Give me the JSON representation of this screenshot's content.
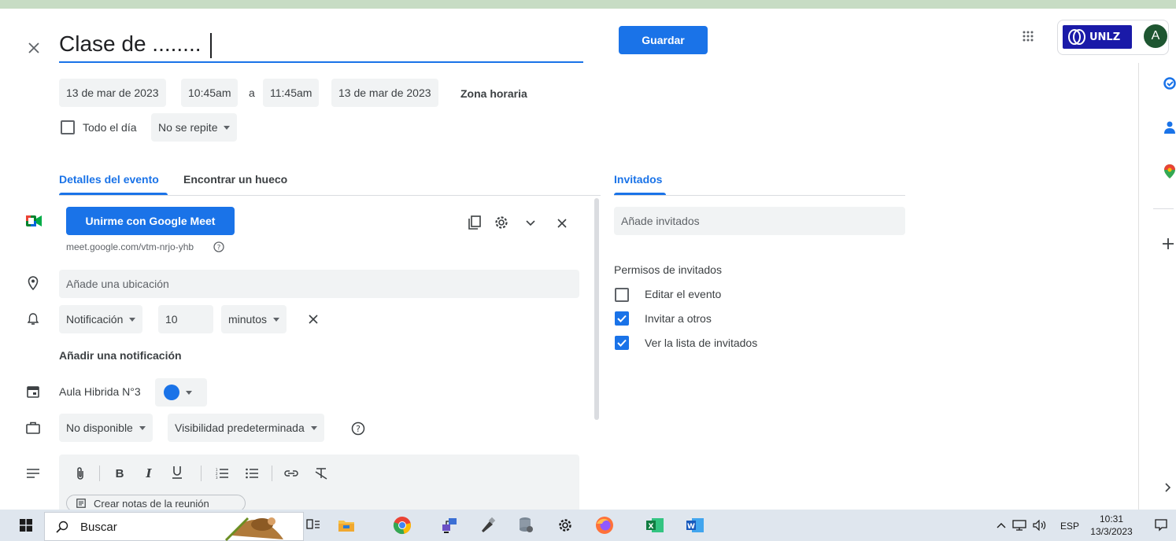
{
  "event": {
    "title": "Clase de ........",
    "save_label": "Guardar",
    "start_date": "13 de mar de 2023",
    "start_time": "10:45am",
    "to_label": "a",
    "end_time": "11:45am",
    "end_date": "13 de mar de 2023",
    "timezone_label": "Zona horaria",
    "all_day_label": "Todo el día",
    "repeat_label": "No se repite"
  },
  "header": {
    "org_logo_text": "UNLZ",
    "avatar_letter": "A"
  },
  "tabs": {
    "details": "Detalles del evento",
    "find_time": "Encontrar un hueco",
    "guests": "Invitados"
  },
  "meet": {
    "join_label": "Unirme con Google Meet",
    "link": "meet.google.com/vtm-nrjo-yhb"
  },
  "location": {
    "placeholder": "Añade una ubicación"
  },
  "notification": {
    "type": "Notificación",
    "amount": "10",
    "unit": "minutos",
    "add_label": "Añadir una notificación"
  },
  "calendar": {
    "name": "Aula Hibrida N°3",
    "color": "#1a73e8"
  },
  "availability": {
    "status": "No disponible",
    "visibility": "Visibilidad predeterminada"
  },
  "description": {
    "notes_label": "Crear notas de la reunión"
  },
  "guests": {
    "placeholder": "Añade invitados",
    "permissions_title": "Permisos de invitados",
    "permissions": [
      {
        "label": "Editar el evento",
        "checked": false
      },
      {
        "label": "Invitar a otros",
        "checked": true
      },
      {
        "label": "Ver la lista de invitados",
        "checked": true
      }
    ]
  },
  "taskbar": {
    "search_placeholder": "Buscar",
    "language": "ESP",
    "time": "10:31",
    "date": "13/3/2023"
  },
  "colors": {
    "accent": "#1a73e8",
    "taskbar_bg": "#dfe6ee"
  }
}
